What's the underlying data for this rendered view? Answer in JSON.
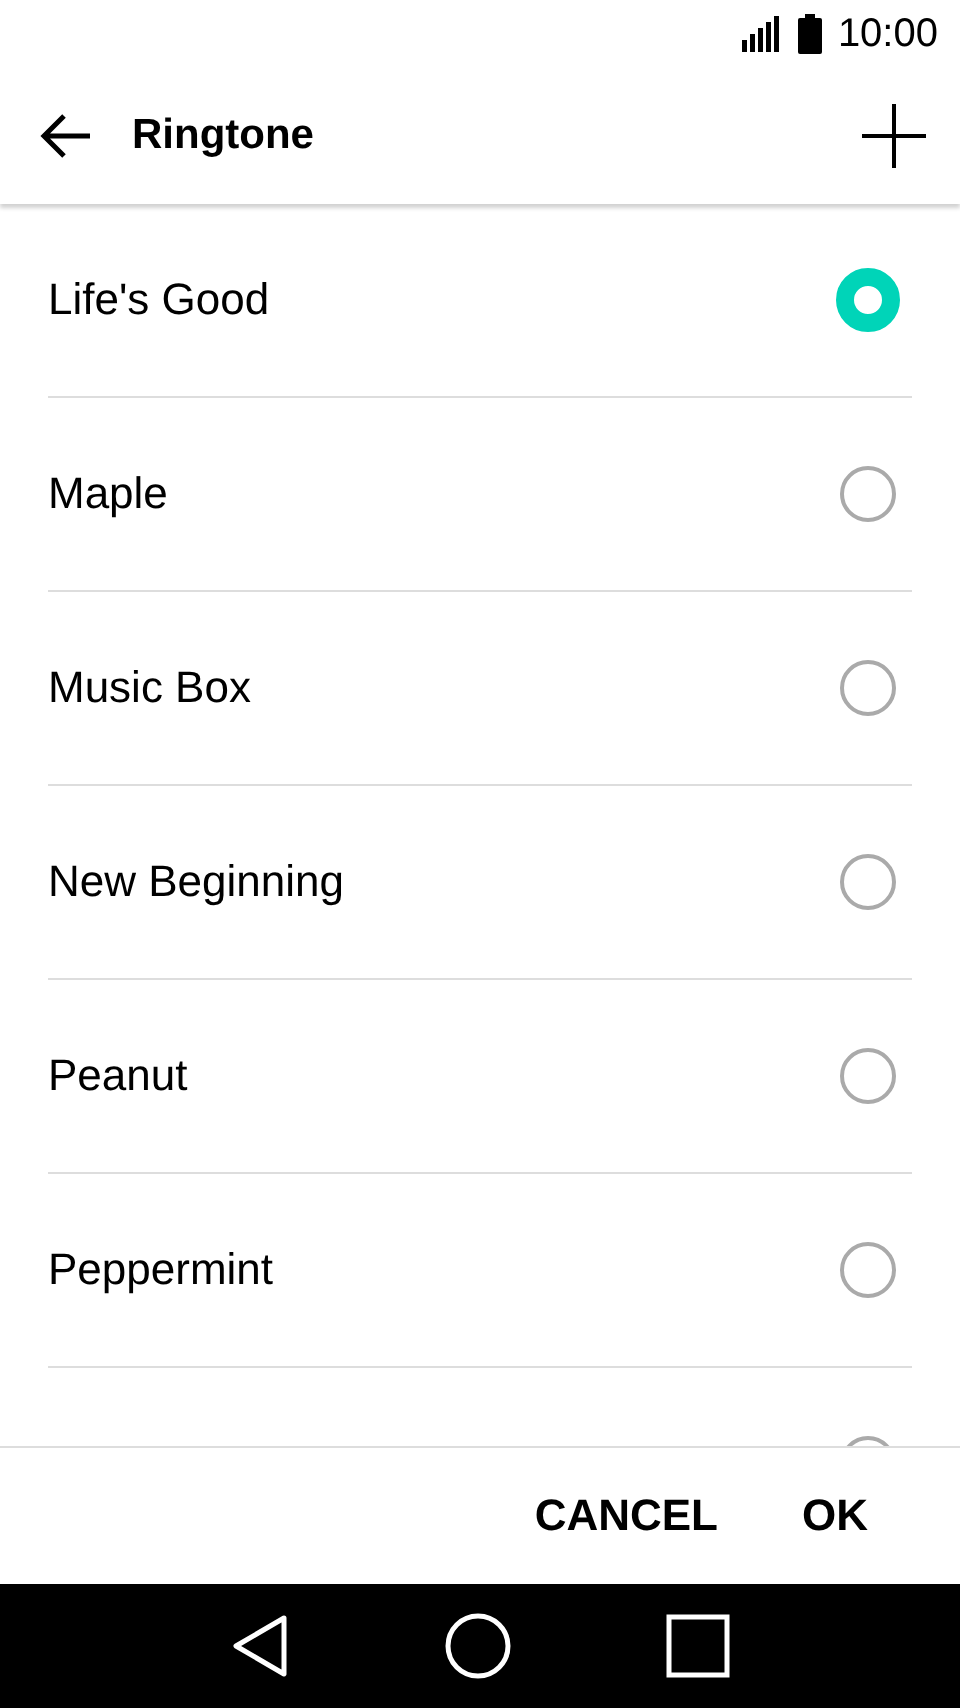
{
  "status_bar": {
    "time": "10:00"
  },
  "toolbar": {
    "title": "Ringtone"
  },
  "ringtones": [
    {
      "label": "Life's Good",
      "selected": true
    },
    {
      "label": "Maple",
      "selected": false
    },
    {
      "label": "Music Box",
      "selected": false
    },
    {
      "label": "New Beginning",
      "selected": false
    },
    {
      "label": "Peanut",
      "selected": false
    },
    {
      "label": "Peppermint",
      "selected": false
    },
    {
      "selected": false
    }
  ],
  "buttons": [
    "CANCEL",
    "OK"
  ]
}
